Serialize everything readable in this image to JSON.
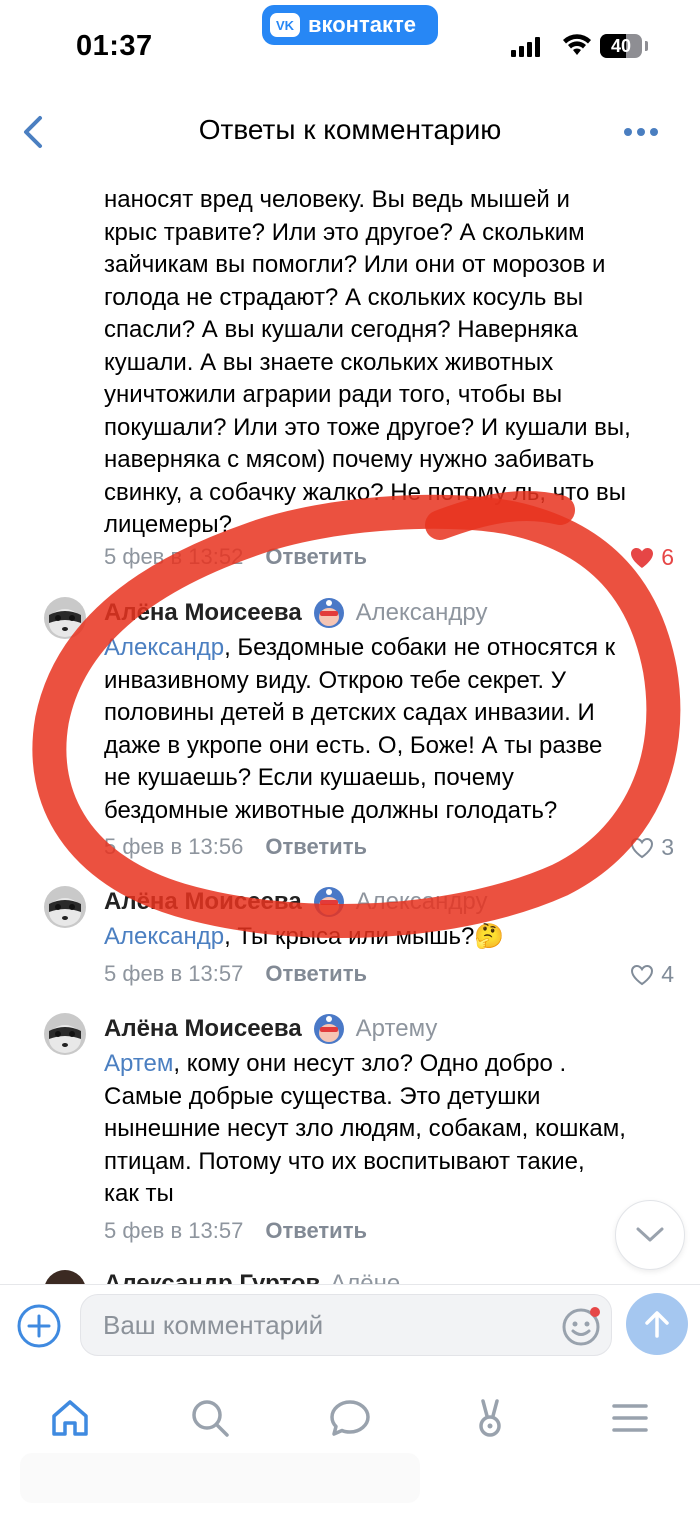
{
  "status_bar": {
    "time": "01:37",
    "app_pill": "вконтакте",
    "battery": "40"
  },
  "header": {
    "title": "Ответы к комментарию"
  },
  "first_comment": {
    "cut_line": "наносят вред человеку. Вы ведь мышей и",
    "lines": [
      "наносят вред человеку. Вы ведь мышей и",
      "крыс травите? Или это другое? А скольким",
      "зайчикам вы помогли? Или они от морозов и",
      "голода не страдают? А скольких косуль вы",
      "спасли? А вы кушали сегодня? Наверняка",
      "кушали. А вы знаете скольких животных",
      "уничтожили аграрии ради того, чтобы вы",
      "покушали? Или это тоже другое? И кушали вы,",
      "наверняка с мясом) почему нужно забивать",
      "свинку, а собачку жалко? Не потому ль, что вы",
      "лицемеры?"
    ],
    "date": "5 фев в 13:52",
    "reply": "Ответить",
    "likes": "6"
  },
  "comments": [
    {
      "author": "Алёна Моисеева",
      "reply_to": "Александру",
      "mention": "Александр",
      "first_line_rest": ", Бездомные собаки не относятся к",
      "lines": [
        "инвазивному виду. Открою тебе секрет. У",
        "половины детей в детских садах инвазии. И",
        "даже в укропе они есть. О, Боже! А  ты разве",
        "не кушаешь? Если кушаешь, почему",
        "бездомные животные должны голодать?"
      ],
      "date": "5 фев в 13:56",
      "reply": "Ответить",
      "likes": "3"
    },
    {
      "author": "Алёна Моисеева",
      "reply_to": "Александру",
      "mention": "Александр",
      "first_line_rest": ", Ты крыса или мышь?🤔",
      "lines": [],
      "date": "5 фев в 13:57",
      "reply": "Ответить",
      "likes": "4"
    },
    {
      "author": "Алёна Моисеева",
      "reply_to": "Артему",
      "mention": "Артем",
      "first_line_rest": ", кому они несут зло? Одно добро .",
      "lines": [
        "Самые добрые существа. Это детушки",
        "нынешние несут зло людям, собакам, кошкам,",
        "птицам. Потому что их воспитывают такие,",
        "как ты"
      ],
      "date": "5 фев в 13:57",
      "reply": "Ответить",
      "likes": ""
    }
  ],
  "partial_comment": {
    "author": "Александр Гуртов",
    "reply_to": "Алёне"
  },
  "input": {
    "placeholder": "Ваш комментарий"
  },
  "colors": {
    "accent": "#2787f5",
    "link": "#4b7fc1",
    "muted": "#8e959e",
    "like_red": "#e64646",
    "annotation_red": "#e8321e"
  },
  "icons": {
    "back": "chevron-left-icon",
    "more": "ellipsis-icon",
    "heart": "heart-icon",
    "add": "plus-circle-icon",
    "emoji": "smile-icon",
    "send": "arrow-up-icon",
    "scroll": "chevron-down-icon",
    "tabs": [
      "home-icon",
      "search-icon",
      "messages-icon",
      "clips-icon",
      "menu-icon"
    ]
  }
}
